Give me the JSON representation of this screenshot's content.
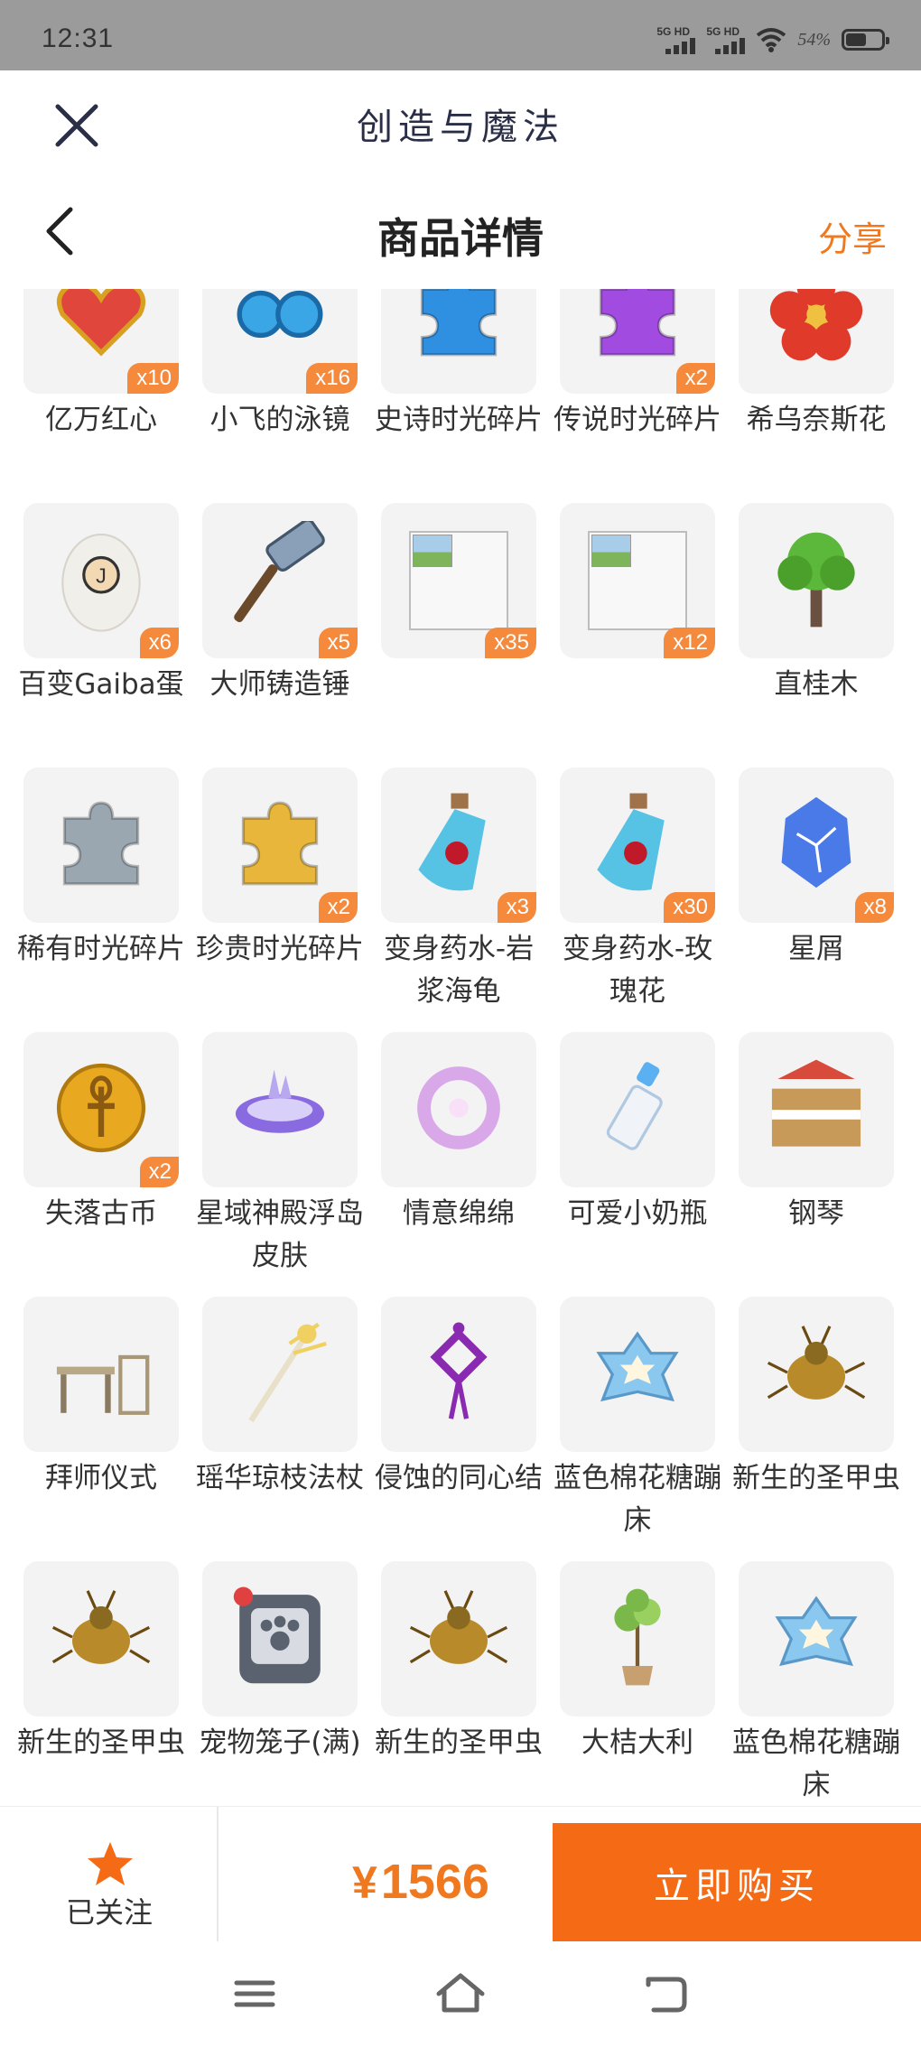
{
  "status_bar": {
    "time": "12:31",
    "signal1_label": "5G HD",
    "signal2_label": "5G HD",
    "battery_pct": "54%"
  },
  "top_bar": {
    "title": "创造与魔法"
  },
  "header": {
    "title": "商品详情",
    "share_label": "分享"
  },
  "items": [
    {
      "name": "亿万红心",
      "count": "x10",
      "icon": "red-heart-icon",
      "color": "#e0463c"
    },
    {
      "name": "小飞的泳镜",
      "count": "x16",
      "icon": "goggles-icon",
      "color": "#3aa6e6"
    },
    {
      "name": "史诗时光碎片",
      "count": "",
      "icon": "blue-puzzle-piece-icon",
      "color": "#2f8fe0"
    },
    {
      "name": "传说时光碎片",
      "count": "x2",
      "icon": "purple-puzzle-piece-icon",
      "color": "#a24be0"
    },
    {
      "name": "希乌奈斯花",
      "count": "",
      "icon": "red-flower-icon",
      "color": "#e03a2a"
    },
    {
      "name": "百变Gaiba蛋",
      "count": "x6",
      "icon": "egg-icon",
      "color": "#f2f0ec"
    },
    {
      "name": "大师铸造锤",
      "count": "x5",
      "icon": "hammer-icon",
      "color": "#7a8fa8"
    },
    {
      "name": "",
      "count": "x35",
      "icon": "broken-image-icon",
      "color": ""
    },
    {
      "name": "",
      "count": "x12",
      "icon": "broken-image-icon",
      "color": ""
    },
    {
      "name": "直桂木",
      "count": "",
      "icon": "tree-icon",
      "color": "#5cb83a"
    },
    {
      "name": "稀有时光碎片",
      "count": "",
      "icon": "gray-puzzle-piece-icon",
      "color": "#9aa7b0"
    },
    {
      "name": "珍贵时光碎片",
      "count": "x2",
      "icon": "gold-puzzle-piece-icon",
      "color": "#e8b63a"
    },
    {
      "name": "变身药水-岩浆海龟",
      "count": "x3",
      "icon": "potion-icon",
      "color": "#3ab8e0"
    },
    {
      "name": "变身药水-玫瑰花",
      "count": "x30",
      "icon": "potion-icon",
      "color": "#3ab8e0"
    },
    {
      "name": "星屑",
      "count": "x8",
      "icon": "stardust-icon",
      "color": "#4a7ae8"
    },
    {
      "name": "失落古币",
      "count": "x2",
      "icon": "gold-coin-icon",
      "color": "#e8a820"
    },
    {
      "name": "星域神殿浮岛皮肤",
      "count": "",
      "icon": "floating-island-icon",
      "color": "#8a6ae0"
    },
    {
      "name": "情意绵绵",
      "count": "",
      "icon": "wreath-icon",
      "color": "#d9a8e8"
    },
    {
      "name": "可爱小奶瓶",
      "count": "",
      "icon": "baby-bottle-icon",
      "color": "#5ab0f0"
    },
    {
      "name": "钢琴",
      "count": "",
      "icon": "piano-icon",
      "color": "#c89a5a"
    },
    {
      "name": "拜师仪式",
      "count": "",
      "icon": "ceremony-table-icon",
      "color": "#b8a888"
    },
    {
      "name": "瑶华琼枝法杖",
      "count": "",
      "icon": "staff-icon",
      "color": "#f0d060"
    },
    {
      "name": "侵蚀的同心结",
      "count": "",
      "icon": "knot-icon",
      "color": "#8a2ab0"
    },
    {
      "name": "蓝色棉花糖蹦床",
      "count": "",
      "icon": "trampoline-icon",
      "color": "#8ac8f0"
    },
    {
      "name": "新生的圣甲虫",
      "count": "",
      "icon": "scarab-icon",
      "color": "#b88a2a"
    },
    {
      "name": "新生的圣甲虫",
      "count": "",
      "icon": "scarab-icon",
      "color": "#b88a2a"
    },
    {
      "name": "宠物笼子(满)",
      "count": "",
      "icon": "pet-cage-icon",
      "color": "#6a7280"
    },
    {
      "name": "新生的圣甲虫",
      "count": "",
      "icon": "scarab-icon",
      "color": "#b88a2a"
    },
    {
      "name": "大桔大利",
      "count": "",
      "icon": "potted-plant-icon",
      "color": "#7ab84a"
    },
    {
      "name": "蓝色棉花糖蹦床",
      "count": "",
      "icon": "trampoline-icon",
      "color": "#8ac8f0"
    }
  ],
  "action_bar": {
    "follow_label": "已关注",
    "currency": "¥",
    "price": "1566",
    "buy_label": "立即购买"
  },
  "colors": {
    "accent": "#f56a14",
    "badge": "#f58a3d",
    "status_bar": "#9b9b9b"
  }
}
